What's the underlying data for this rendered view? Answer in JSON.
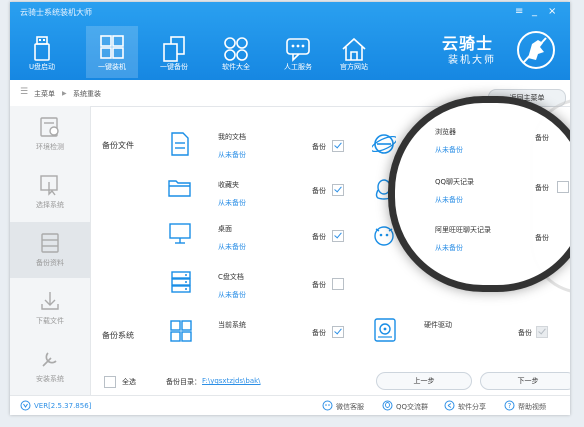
{
  "window": {
    "title": "云骑士系统装机大师",
    "menu_glyph": "≡",
    "min_glyph": "_",
    "close_glyph": "×"
  },
  "nav": [
    {
      "label": "U盘启动",
      "icon": "usb-icon"
    },
    {
      "label": "一键装机",
      "icon": "windows-icon"
    },
    {
      "label": "一键备份",
      "icon": "backup-icon"
    },
    {
      "label": "软件大全",
      "icon": "apps-icon"
    },
    {
      "label": "人工服务",
      "icon": "chat-icon"
    },
    {
      "label": "官方网站",
      "icon": "home-icon"
    }
  ],
  "brand": {
    "line1": "云骑士",
    "line2": "装机大师"
  },
  "breadcrumb": {
    "menu_glyph": "☰",
    "home": "主菜单",
    "sep": "▶",
    "current": "系统重装",
    "return_label": "返回主菜单"
  },
  "sidebar": [
    {
      "label": "环境检测",
      "icon": "check-env-icon"
    },
    {
      "label": "选择系统",
      "icon": "select-system-icon"
    },
    {
      "label": "备份资料",
      "icon": "backup-data-icon"
    },
    {
      "label": "下载文件",
      "icon": "download-icon"
    },
    {
      "label": "安装系统",
      "icon": "install-icon"
    }
  ],
  "backup_files": {
    "section_label": "备份文件",
    "backup_label": "备份",
    "items": [
      {
        "name": "我的文档",
        "status": "从未备份",
        "checked": true
      },
      {
        "name": "收藏夹",
        "status": "从未备份",
        "checked": true
      },
      {
        "name": "桌面",
        "status": "从未备份",
        "checked": true
      },
      {
        "name": "C盘文档",
        "status": "从未备份",
        "checked": false
      }
    ],
    "right_items": [
      {
        "name": "浏览器",
        "status": "从未备份"
      },
      {
        "name": "QQ聊天记录",
        "status": "从未备份"
      },
      {
        "name": "阿里旺旺聊天记录",
        "status": "从未备份"
      }
    ]
  },
  "backup_system": {
    "section_label": "备份系统",
    "current": "当前系统",
    "driver": "硬件驱动",
    "backup_label": "备份"
  },
  "footer_row": {
    "select_all": "全选",
    "dir_label": "备份目录：",
    "dir_path": "F:\\yqsxtzjds\\bak\\",
    "prev": "上一步",
    "next": "下一步"
  },
  "status_bar": {
    "version": "VER[2.5.37.856]",
    "links": [
      "微信客服",
      "QQ交流群",
      "软件分享",
      "帮助视频"
    ]
  },
  "colors": {
    "accent": "#1a8ee6",
    "link": "#2c8fe6"
  }
}
